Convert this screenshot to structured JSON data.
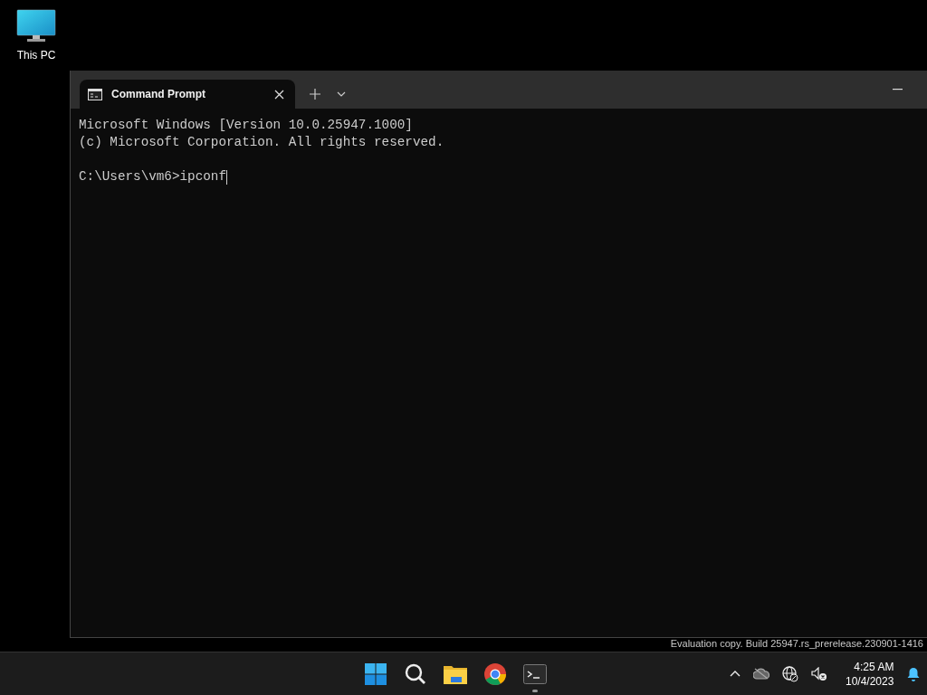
{
  "desktop": {
    "icons": [
      {
        "label": "This PC"
      }
    ],
    "watermark": "Evaluation copy. Build 25947.rs_prerelease.230901-1416"
  },
  "window": {
    "tabs": [
      {
        "title": "Command Prompt",
        "selected": true
      }
    ],
    "console_lines": [
      "Microsoft Windows [Version 10.0.25947.1000]",
      "(c) Microsoft Corporation. All rights reserved."
    ],
    "prompt_line": "C:\\Users\\vm6>ipconf"
  },
  "taskbar": {
    "apps": [
      {
        "kind": "start",
        "running": false
      },
      {
        "kind": "search",
        "running": false
      },
      {
        "kind": "explorer",
        "running": false
      },
      {
        "kind": "chrome",
        "running": false
      },
      {
        "kind": "terminal",
        "running": true
      }
    ],
    "clock": {
      "time": "4:25 AM",
      "date": "10/4/2023"
    }
  }
}
